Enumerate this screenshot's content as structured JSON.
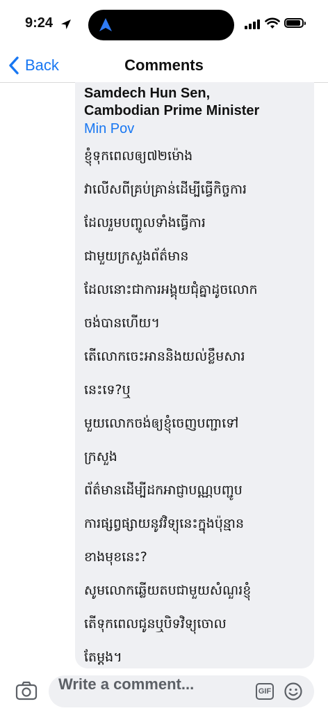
{
  "status_bar": {
    "time": "9:24"
  },
  "header": {
    "back_label": "Back",
    "title": "Comments"
  },
  "comment": {
    "quoted_author": [
      "Samdech Hun Sen,",
      "Cambodian Prime Minister"
    ],
    "commenter_name": "Min Pov",
    "text_lines": [
      "ខ្ញុំទុកពេលឲ្យ៧២ម៉ោង",
      "វាលើសពីគ្រប់គ្រាន់ដើម្បីធ្វើកិច្ចការ",
      "ដែលរួមបញ្ចូលទាំងធ្វើការ",
      "ជាមួយក្រសួងព័ត៌មាន",
      "ដែលនោះជាការអង្គុយជុំគ្នាដូចលោក",
      "ចង់បានហើយ។",
      "តើលោកចេះអាននិងយល់ខ្លឹមសារ",
      "នេះទេ?ឬ",
      "មួយលោកចង់ឲ្យខ្ញុំចេញបញ្ជាទៅ",
      "ក្រសួង",
      "ព័ត៌មានដើម្បីដកអាជ្ញាបណ្ណបញ្ជូប",
      "ការផ្សព្វផ្សាយនូវវិទ្យុនេះក្នុងប៉ុន្មាន",
      "ខាងមុខនេះ?",
      "សូមលោកឆ្លើយតបជាមួយសំណួរខ្ញុំ",
      "តើទុកពេលជូនឬបិទវិទ្យុចោល",
      "តែម្តង។"
    ]
  },
  "composer": {
    "placeholder": "Write a comment...",
    "gif_label": "GIF"
  },
  "colors": {
    "accent": "#1877f2",
    "bubble": "#eff0f3"
  },
  "icons": [
    "location-arrow-icon",
    "navigation-icon",
    "signal-icon",
    "wifi-icon",
    "battery-icon",
    "back-chevron-icon",
    "camera-icon",
    "gif-icon",
    "emoji-icon"
  ]
}
